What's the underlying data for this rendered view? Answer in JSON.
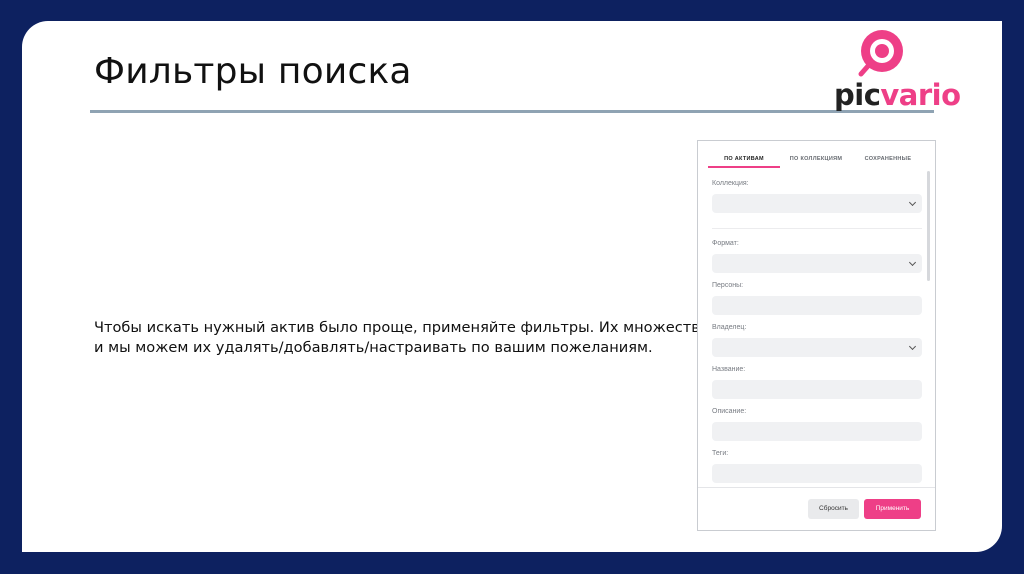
{
  "slide": {
    "title": "Фильтры поиска",
    "description_lines": [
      "Чтобы искать нужный актив было проще, применяйте фильтры. Их множество,",
      "и мы можем их удалять/добавлять/настраивать по вашим пожеланиям."
    ]
  },
  "logo": {
    "part1": "pic",
    "part2": "vario",
    "accent": "#ee3f87"
  },
  "panel": {
    "tabs": [
      {
        "label": "ПО АКТИВАМ",
        "active": true
      },
      {
        "label": "ПО КОЛЛЕКЦИЯМ",
        "active": false
      },
      {
        "label": "СОХРАНЕННЫЕ",
        "active": false
      }
    ],
    "fields": [
      {
        "label": "Коллекция:",
        "dropdown": true
      },
      {
        "label": "Формат:",
        "dropdown": true
      },
      {
        "label": "Персоны:",
        "dropdown": false
      },
      {
        "label": "Владелец:",
        "dropdown": true
      },
      {
        "label": "Название:",
        "dropdown": false
      },
      {
        "label": "Описание:",
        "dropdown": false
      },
      {
        "label": "Теги:",
        "dropdown": false
      }
    ],
    "reset_label": "Сбросить",
    "apply_label": "Применить"
  },
  "colors": {
    "background": "#0d2160",
    "accent": "#ee3f87",
    "rule": "#8fa3b3"
  }
}
